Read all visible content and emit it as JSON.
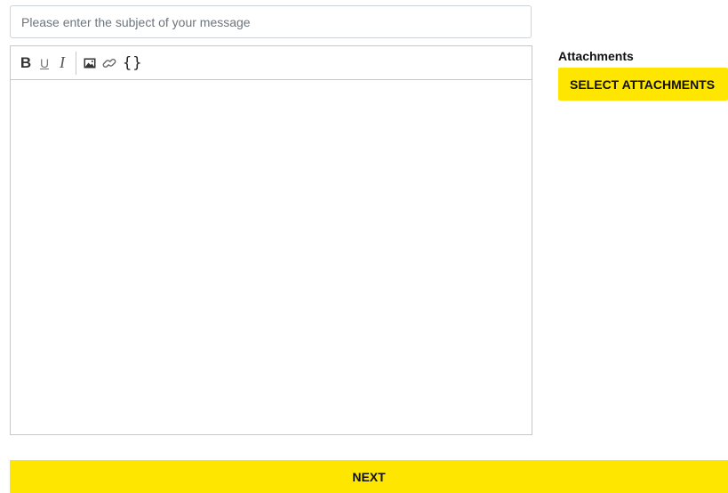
{
  "subject": {
    "placeholder": "Please enter the subject of your message",
    "value": ""
  },
  "toolbar": {
    "bold_label": "B",
    "underline_label": "U",
    "italic_label": "I",
    "image_icon": "image-icon",
    "link_icon": "link-icon",
    "code_label": "{}"
  },
  "attachments": {
    "title": "Attachments",
    "button_label": "SELECT ATTACHMENTS"
  },
  "footer": {
    "next_label": "NEXT"
  },
  "colors": {
    "accent": "#ffe600",
    "border": "#c8c8c8"
  }
}
